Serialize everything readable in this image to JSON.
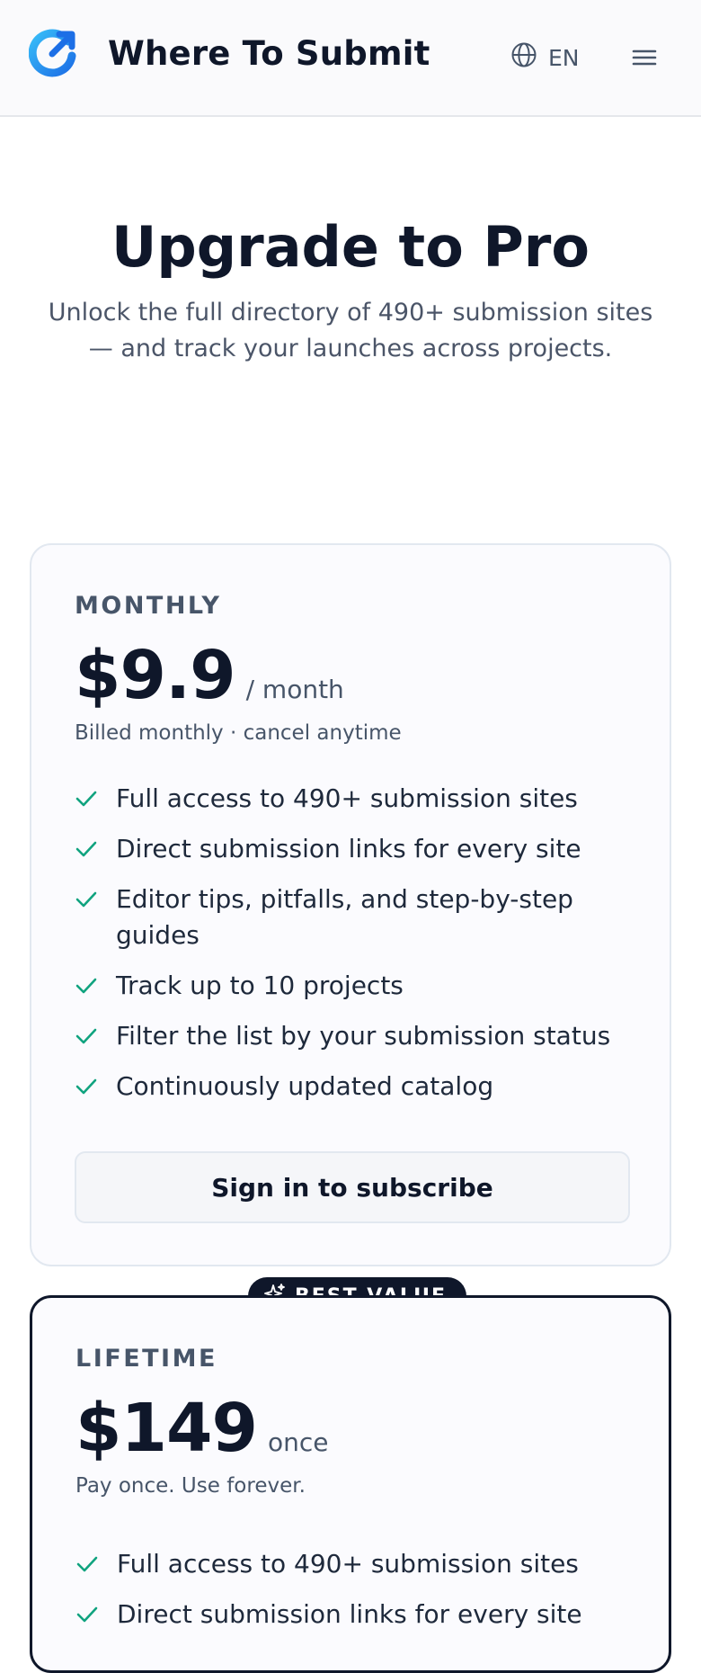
{
  "header": {
    "brand": "Where To Submit",
    "language": "EN",
    "icons": {
      "logo": "circular-arrow-logo",
      "language": "globe-icon",
      "menu": "hamburger-menu-icon"
    }
  },
  "hero": {
    "title": "Upgrade to Pro",
    "subtitle": "Unlock the full directory of 490+ submission sites — and track your launches across projects."
  },
  "plans": {
    "monthly": {
      "name": "MONTHLY",
      "price": "$9.9",
      "period": "/ month",
      "note": "Billed monthly · cancel anytime",
      "features": [
        "Full access to 490+ submission sites",
        "Direct submission links for every site",
        "Editor tips, pitfalls, and step-by-step guides",
        "Track up to 10 projects",
        "Filter the list by your submission status",
        "Continuously updated catalog"
      ],
      "cta": "Sign in to subscribe"
    },
    "lifetime": {
      "badge": "BEST VALUE",
      "name": "LIFETIME",
      "price": "$149",
      "period": "once",
      "note": "Pay once. Use forever.",
      "features": [
        "Full access to 490+ submission sites",
        "Direct submission links for every site"
      ]
    }
  },
  "colors": {
    "accent": "#1d8ee6",
    "check": "#10a37f",
    "text": "#0f172a",
    "muted": "#475569"
  }
}
